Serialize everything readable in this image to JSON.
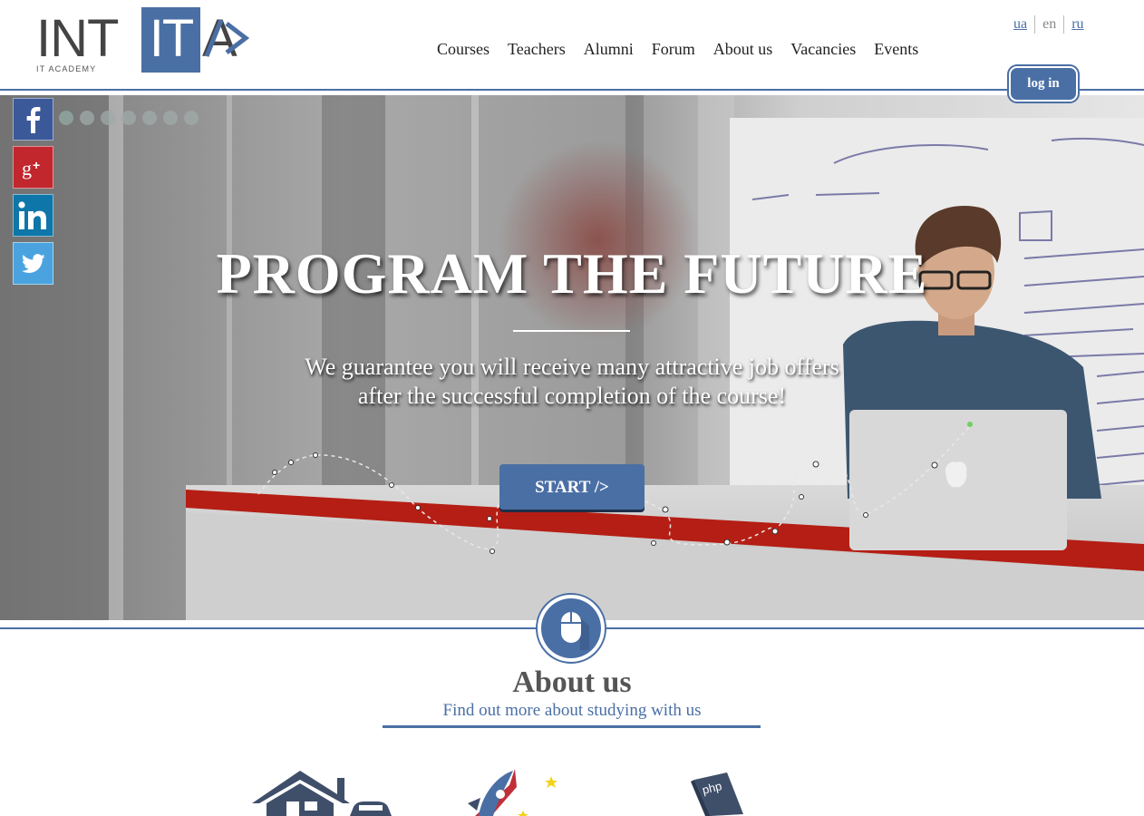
{
  "header": {
    "logo": {
      "main": "INTITA",
      "slash": "/>",
      "sub": "IT ACADEMY"
    },
    "nav": [
      "Courses",
      "Teachers",
      "Alumni",
      "Forum",
      "About us",
      "Vacancies",
      "Events"
    ],
    "languages": [
      {
        "code": "ua",
        "active": false
      },
      {
        "code": "en",
        "active": true
      },
      {
        "code": "ru",
        "active": false
      }
    ],
    "login_label": "log in"
  },
  "social": [
    "facebook-icon",
    "google-plus-icon",
    "linkedin-icon",
    "twitter-icon"
  ],
  "hero": {
    "title": "PROGRAM THE FUTURE",
    "subtitle_line1": "We guarantee you will receive many attractive job offers",
    "subtitle_line2": "after the successful completion of the course!",
    "start_label": "START />",
    "slide_count": 7,
    "active_slide": 1
  },
  "about": {
    "title": "About us",
    "subtitle": "Find out more about studying with us",
    "features": [
      "house-car-icon",
      "rocket-icon",
      "php-book-icon"
    ]
  },
  "colors": {
    "brand": "#4a6fa5",
    "facebook": "#3b5998",
    "google_plus": "#c1272d",
    "linkedin": "#0e76a8",
    "twitter": "#4aa3df"
  }
}
